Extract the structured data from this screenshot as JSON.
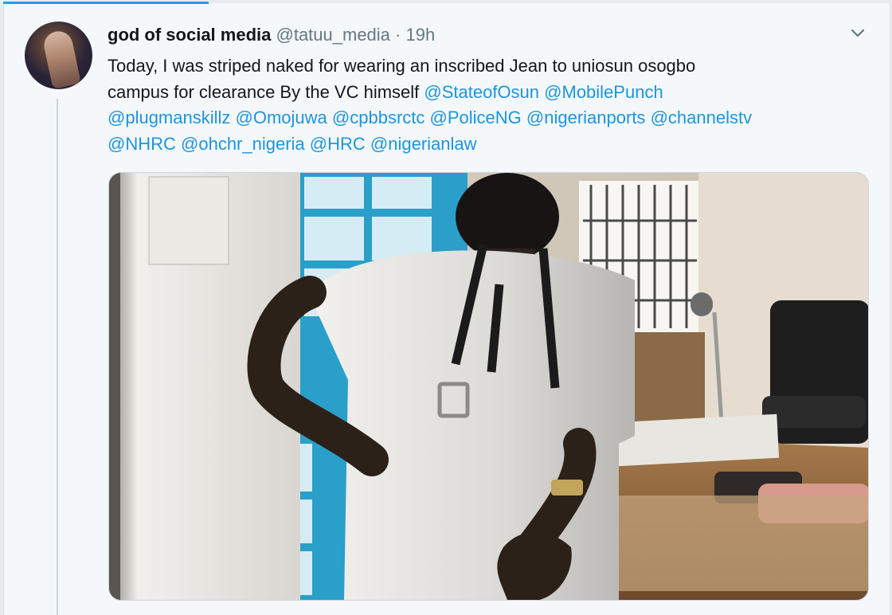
{
  "tweet": {
    "display_name": "god of social media",
    "handle": "@tatuu_media",
    "separator": "·",
    "time": "19h",
    "text_lines": [
      [
        {
          "t": "Today, I was striped naked for wearing an inscribed Jean to uniosun osogbo",
          "m": false
        }
      ],
      [
        {
          "t": "campus for clearance By the VC himself ",
          "m": false
        },
        {
          "t": "@StateofOsun",
          "m": true
        },
        {
          "t": " ",
          "m": false
        },
        {
          "t": "@MobilePunch",
          "m": true
        }
      ],
      [
        {
          "t": "@plugmanskillz",
          "m": true
        },
        {
          "t": " ",
          "m": false
        },
        {
          "t": "@Omojuwa",
          "m": true
        },
        {
          "t": " ",
          "m": false
        },
        {
          "t": "@cpbbsrctc",
          "m": true
        },
        {
          "t": " ",
          "m": false
        },
        {
          "t": "@PoliceNG",
          "m": true
        },
        {
          "t": " ",
          "m": false
        },
        {
          "t": "@nigerianports",
          "m": true
        },
        {
          "t": " ",
          "m": false
        },
        {
          "t": "@channelstv",
          "m": true
        }
      ],
      [
        {
          "t": "@NHRC",
          "m": true
        },
        {
          "t": " ",
          "m": false
        },
        {
          "t": "@ohchr_nigeria",
          "m": true
        },
        {
          "t": " ",
          "m": false
        },
        {
          "t": "@HRC",
          "m": true
        },
        {
          "t": " ",
          "m": false
        },
        {
          "t": "@nigerianlaw",
          "m": true
        }
      ]
    ],
    "icons": {
      "avatar": "profile-photo",
      "caret": "chevron-down-icon"
    },
    "colors": {
      "link": "#1b95e0",
      "text": "#14171a",
      "muted": "#657786",
      "accent": "#1da1f2"
    }
  }
}
